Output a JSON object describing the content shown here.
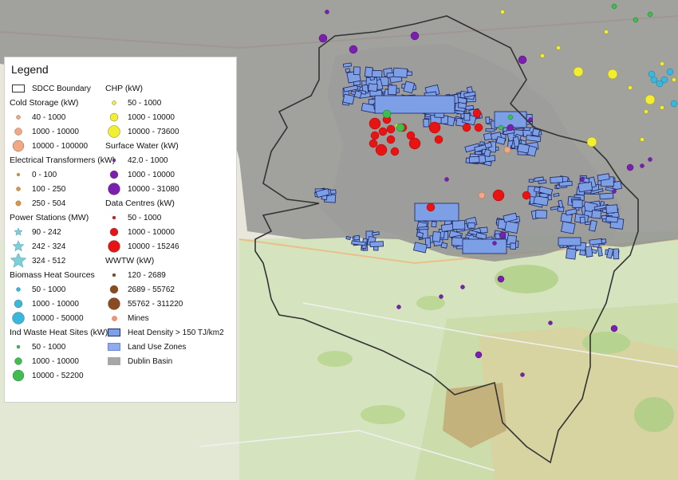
{
  "legend": {
    "title": "Legend",
    "boundary": {
      "label": "SDCC Boundary"
    },
    "col1": [
      {
        "heading": "Cold Storage (kW)",
        "color": "#f2a882",
        "items": [
          {
            "label": "40 - 1000",
            "r": 2.5
          },
          {
            "label": "1000 - 10000",
            "r": 4.5
          },
          {
            "label": "10000 - 100000",
            "r": 7
          }
        ]
      },
      {
        "heading": "Electrical Transformers (kW)",
        "color": "#e2963a",
        "items": [
          {
            "label": "0 - 100",
            "r": 1.8
          },
          {
            "label": "100 - 250",
            "r": 2.5
          },
          {
            "label": "250 - 504",
            "r": 3.2
          }
        ]
      },
      {
        "heading": "Power Stations (MW)",
        "color": "#7ecfd8",
        "star": true,
        "items": [
          {
            "label": "90 - 242",
            "r": 5
          },
          {
            "label": "242 - 324",
            "r": 7
          },
          {
            "label": "324 - 512",
            "r": 10
          }
        ]
      },
      {
        "heading": "Biomass Heat Sources",
        "color": "#3ab8dc",
        "items": [
          {
            "label": "50 - 1000",
            "r": 2.5
          },
          {
            "label": "1000 - 10000",
            "r": 5
          },
          {
            "label": "10000 - 50000",
            "r": 7.5
          }
        ]
      },
      {
        "heading": "Ind Waste Heat Sites (kW)",
        "color": "#3fbe4e",
        "items": [
          {
            "label": "50 - 1000",
            "r": 2
          },
          {
            "label": "1000 - 10000",
            "r": 4.5
          },
          {
            "label": "10000 - 52200",
            "r": 7
          }
        ]
      }
    ],
    "col2": [
      {
        "heading": "CHP (kW)",
        "color": "#f2ee30",
        "items": [
          {
            "label": "50 - 1000",
            "r": 2.5
          },
          {
            "label": "1000 - 10000",
            "r": 5
          },
          {
            "label": "10000 - 73600",
            "r": 7.5
          }
        ]
      },
      {
        "heading": "Surface Water (kW)",
        "color": "#7a1fb0",
        "items": [
          {
            "label": "42.0 - 1000",
            "r": 2
          },
          {
            "label": "1000 - 10000",
            "r": 5
          },
          {
            "label": "10000 - 31080",
            "r": 7.5
          }
        ]
      },
      {
        "heading": "Data Centres (kW)",
        "color": "#e81414",
        "items": [
          {
            "label": "50 - 1000",
            "r": 2
          },
          {
            "label": "1000 - 10000",
            "r": 5
          },
          {
            "label": "10000 - 15246",
            "r": 7.5
          }
        ]
      },
      {
        "heading": "WWTW (kW)",
        "color": "#8a4a22",
        "items": [
          {
            "label": "120 - 2689",
            "r": 2
          },
          {
            "label": "2689 - 55762",
            "r": 5
          },
          {
            "label": "55762 - 311220",
            "r": 7.5
          }
        ]
      }
    ],
    "extras": [
      {
        "label": "Mines",
        "kind": "dot",
        "color": "#e8957e"
      },
      {
        "label": "Heat Density > 150 TJ/km2",
        "kind": "square",
        "color": "#7d9fe6",
        "stroke": "#1f2e78"
      },
      {
        "label": "Land Use Zones",
        "kind": "square",
        "color": "#8faaf0",
        "stroke": "#6a88d6"
      },
      {
        "label": "Dublin Basin",
        "kind": "square",
        "color": "#a7a7a7",
        "stroke": "#a7a7a7"
      }
    ]
  },
  "map_colors": {
    "base_green": "#d9e7c3",
    "base_light": "#ece9df",
    "basin_grey": "#8f8f8f",
    "heat_blue": "#7d9fe6",
    "heat_outline": "#1a2460",
    "boundary": "#333333",
    "forest": "#b4d08e",
    "mountain": "#cfc99a",
    "park_brown": "#c9b27a"
  }
}
